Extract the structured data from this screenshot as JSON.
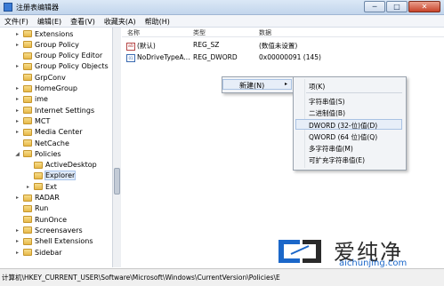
{
  "window": {
    "title": "注册表编辑器",
    "min_label": "─",
    "max_label": "□",
    "close_label": "✕"
  },
  "menubar": [
    "文件(F)",
    "编辑(E)",
    "查看(V)",
    "收藏夹(A)",
    "帮助(H)"
  ],
  "tree": [
    {
      "label": "Extensions",
      "level": 1,
      "expander": "▸"
    },
    {
      "label": "Group Policy",
      "level": 1,
      "expander": "▸"
    },
    {
      "label": "Group Policy Editor",
      "level": 1,
      "expander": ""
    },
    {
      "label": "Group Policy Objects",
      "level": 1,
      "expander": "▸"
    },
    {
      "label": "GrpConv",
      "level": 1,
      "expander": ""
    },
    {
      "label": "HomeGroup",
      "level": 1,
      "expander": "▸"
    },
    {
      "label": "ime",
      "level": 1,
      "expander": "▸"
    },
    {
      "label": "Internet Settings",
      "level": 1,
      "expander": "▸"
    },
    {
      "label": "MCT",
      "level": 1,
      "expander": "▸"
    },
    {
      "label": "Media Center",
      "level": 1,
      "expander": "▸"
    },
    {
      "label": "NetCache",
      "level": 1,
      "expander": ""
    },
    {
      "label": "Policies",
      "level": 1,
      "expander": "◢"
    },
    {
      "label": "ActiveDesktop",
      "level": 2,
      "expander": ""
    },
    {
      "label": "Explorer",
      "level": 2,
      "expander": "",
      "selected": true
    },
    {
      "label": "Ext",
      "level": 2,
      "expander": "▸"
    },
    {
      "label": "RADAR",
      "level": 1,
      "expander": "▸"
    },
    {
      "label": "Run",
      "level": 1,
      "expander": ""
    },
    {
      "label": "RunOnce",
      "level": 1,
      "expander": ""
    },
    {
      "label": "Screensavers",
      "level": 1,
      "expander": "▸"
    },
    {
      "label": "Shell Extensions",
      "level": 1,
      "expander": "▸"
    },
    {
      "label": "Sidebar",
      "level": 1,
      "expander": "▸"
    }
  ],
  "list": {
    "headers": {
      "name": "名称",
      "type": "类型",
      "data": "数据"
    },
    "rows": [
      {
        "icon": "ab",
        "name": "(默认)",
        "type": "REG_SZ",
        "data": "(数值未设置)"
      },
      {
        "icon": "bin",
        "name": "NoDriveTypeA...",
        "type": "REG_DWORD",
        "data": "0x00000091 (145)"
      }
    ]
  },
  "context_menu": {
    "new_label": "新建(N)",
    "arrow": "▸",
    "submenu": [
      "项(K)",
      "字符串值(S)",
      "二进制值(B)",
      "DWORD (32-位)值(D)",
      "QWORD (64 位)值(Q)",
      "多字符串值(M)",
      "可扩充字符串值(E)"
    ]
  },
  "statusbar": {
    "path": "计算机\\HKEY_CURRENT_USER\\Software\\Microsoft\\Windows\\CurrentVersion\\Policies\\E"
  },
  "watermark": {
    "cn": "爱纯净",
    "url": "aichunjing.com"
  }
}
